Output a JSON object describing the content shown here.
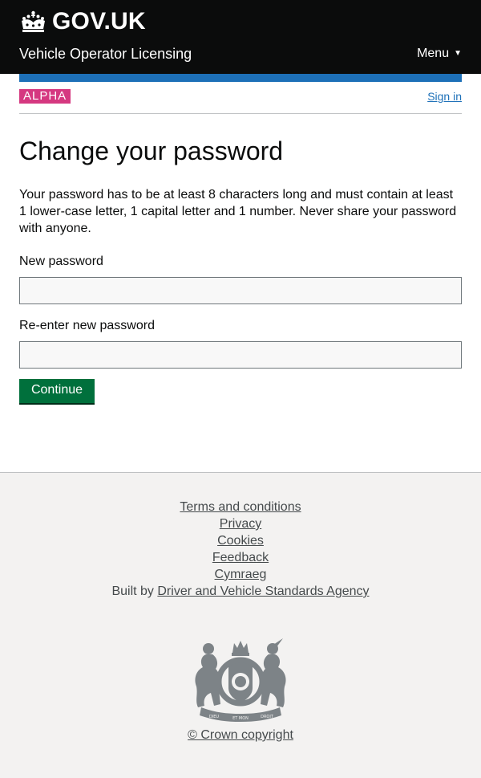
{
  "header": {
    "logo_text": "GOV.UK",
    "service_name": "Vehicle Operator Licensing",
    "menu_label": "Menu",
    "menu_arrow": "▼"
  },
  "phase": {
    "tag": "ALPHA",
    "sign_in": "Sign in"
  },
  "main": {
    "title": "Change your password",
    "intro": "Your password has to be at least 8 characters long and must contain at least 1 lower-case letter, 1 capital letter and 1 number. Never share your password with anyone.",
    "new_password_label": "New password",
    "new_password_value": "",
    "reenter_password_label": "Re-enter new password",
    "reenter_password_value": "",
    "continue_label": "Continue"
  },
  "footer": {
    "links": [
      "Terms and conditions",
      "Privacy",
      "Cookies",
      "Feedback",
      "Cymraeg"
    ],
    "built_by_prefix": "Built by ",
    "built_by_link": "Driver and Vehicle Standards Agency",
    "crest_motto_top": "HONI SOIT QUI MAL Y PENSE",
    "crest_motto_bottom_left": "DIEU",
    "crest_motto_bottom_center": "ET MON",
    "crest_motto_bottom_right": "DROIT",
    "copyright": "© Crown copyright"
  },
  "colors": {
    "header_bg": "#0b0c0c",
    "blue_bar": "#1d70b8",
    "phase_tag": "#d53880",
    "link": "#1d70b8",
    "button": "#00703c",
    "footer_bg": "#f3f2f1"
  },
  "icons": {
    "logo": "crown-icon",
    "menu": "triangle-down-icon",
    "crest": "royal-coat-of-arms"
  }
}
